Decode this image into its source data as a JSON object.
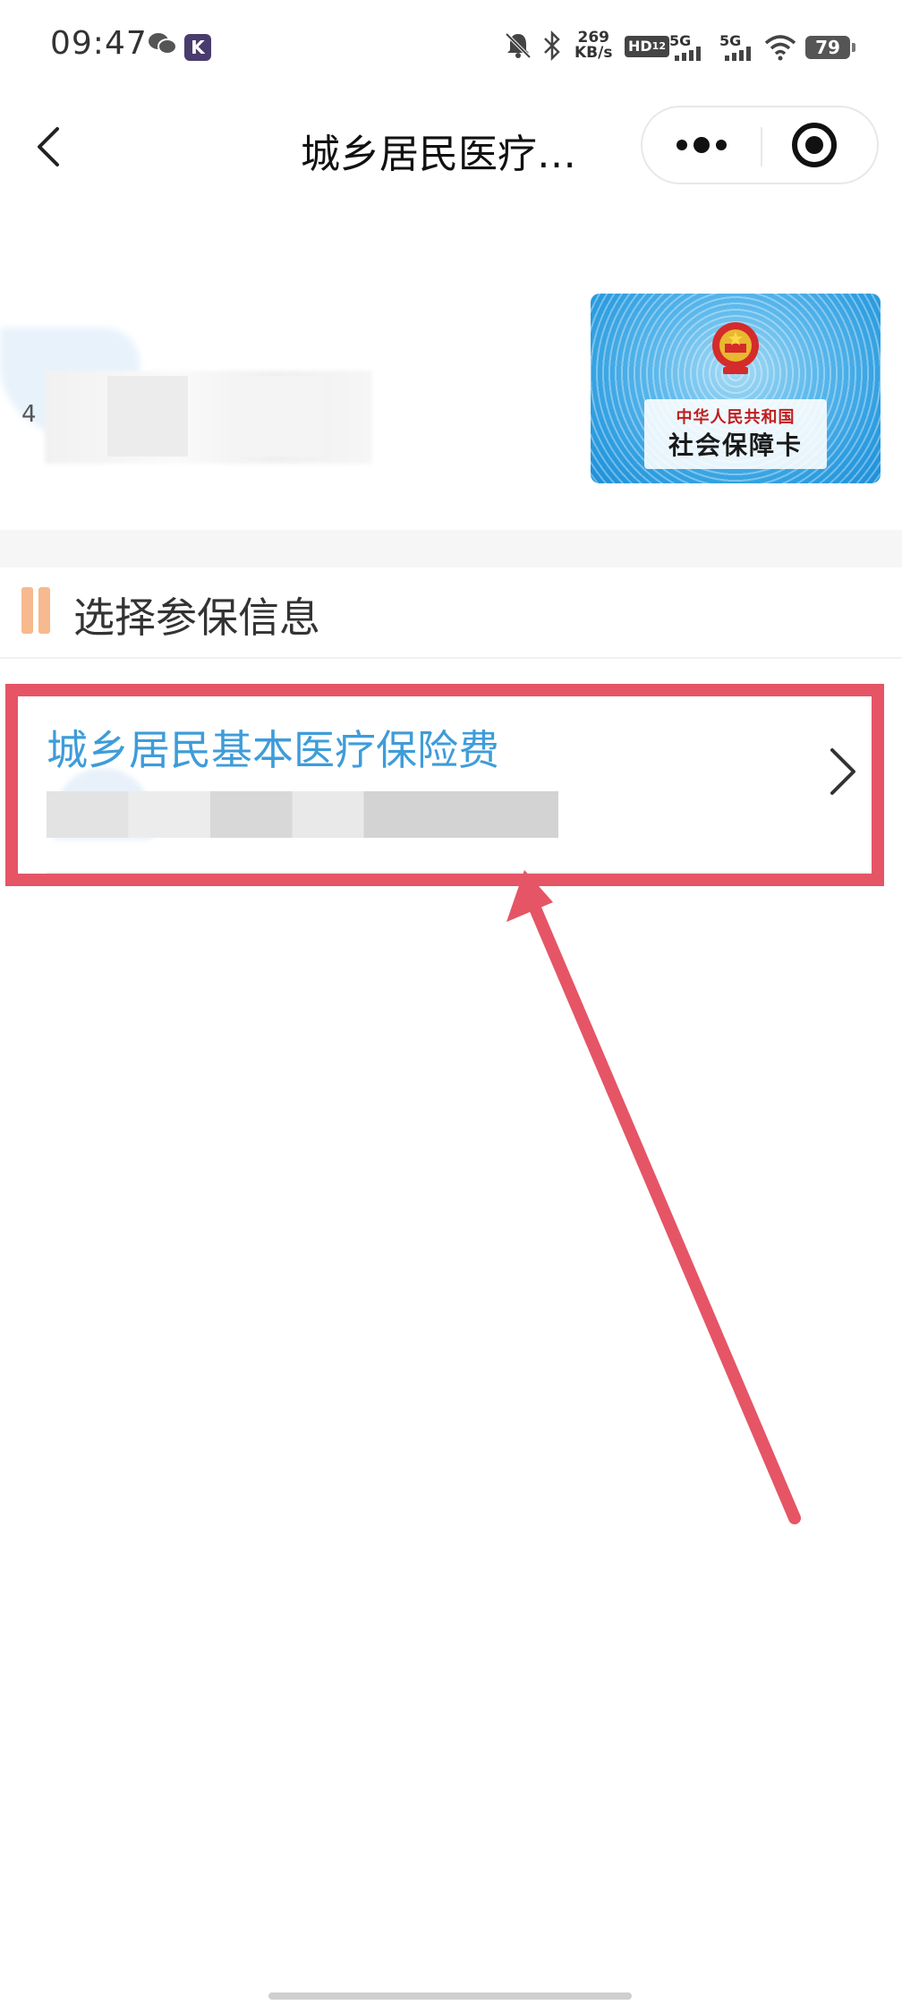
{
  "status_bar": {
    "time": "09:47",
    "net_speed_value": "269",
    "net_speed_unit": "KB/s",
    "hd_label": "HD",
    "hd_sup": "1",
    "hd_sub": "2",
    "signal_1": "5G",
    "signal_2": "5G",
    "battery": "79",
    "icons": [
      "wechat-icon",
      "app-k-icon",
      "mute-bell-icon",
      "bluetooth-icon",
      "signal-icon",
      "wifi-icon",
      "battery-icon"
    ],
    "app_k_label": "K"
  },
  "nav": {
    "title": "城乡居民医疗…"
  },
  "user": {
    "digit": "4"
  },
  "ss_card": {
    "top_text": "中华人民共和国",
    "main_text": "社会保障卡"
  },
  "section": {
    "title": "选择参保信息"
  },
  "insurance_item": {
    "title": "城乡居民基本医疗保险费"
  },
  "colors": {
    "accent_blue": "#3e9cd9",
    "annotation_red": "#e55566",
    "section_marker": "#f7b98e"
  }
}
